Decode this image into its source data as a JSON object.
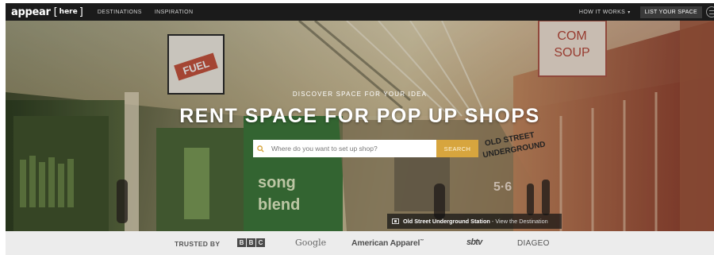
{
  "navbar": {
    "logo_text": "appear",
    "logo_box_text": "here",
    "links": [
      "DESTINATIONS",
      "INSPIRATION"
    ],
    "how_it_works": "HOW IT WORKS",
    "how_it_works_caret": "▾",
    "list_your_space": "LIST YOUR SPACE"
  },
  "hero": {
    "tagline": "DISCOVER SPACE FOR YOUR IDEA",
    "headline": "RENT SPACE FOR POP UP SHOPS",
    "search": {
      "placeholder": "Where do you want to set up shop?",
      "value": "",
      "button_label": "SEARCH",
      "accent_color": "#d7a53e"
    },
    "caption": {
      "place": "Old Street Underground Station",
      "separator": "-",
      "link": "View the Destination"
    },
    "scene_signs": {
      "fuel": "FUEL",
      "com_soup_line1": "COM",
      "com_soup_line2": "SOUP",
      "song_line1": "song",
      "song_line2": "blend",
      "old_street_line1": "OLD STREET",
      "old_street_line2": "UNDERGROUND",
      "fifty_six": "5·6"
    }
  },
  "trusted": {
    "label": "TRUSTED BY",
    "logos": {
      "bbc": [
        "B",
        "B",
        "C"
      ],
      "google": "Google",
      "american_apparel": "American Apparel",
      "american_apparel_mark": "™",
      "sbtv": "sbtv",
      "diageo": "DIAGEO"
    }
  },
  "colors": {
    "nav_bg": "#1b1b1b",
    "search_button": "#d7a53e",
    "trusted_bg": "#ececec"
  }
}
